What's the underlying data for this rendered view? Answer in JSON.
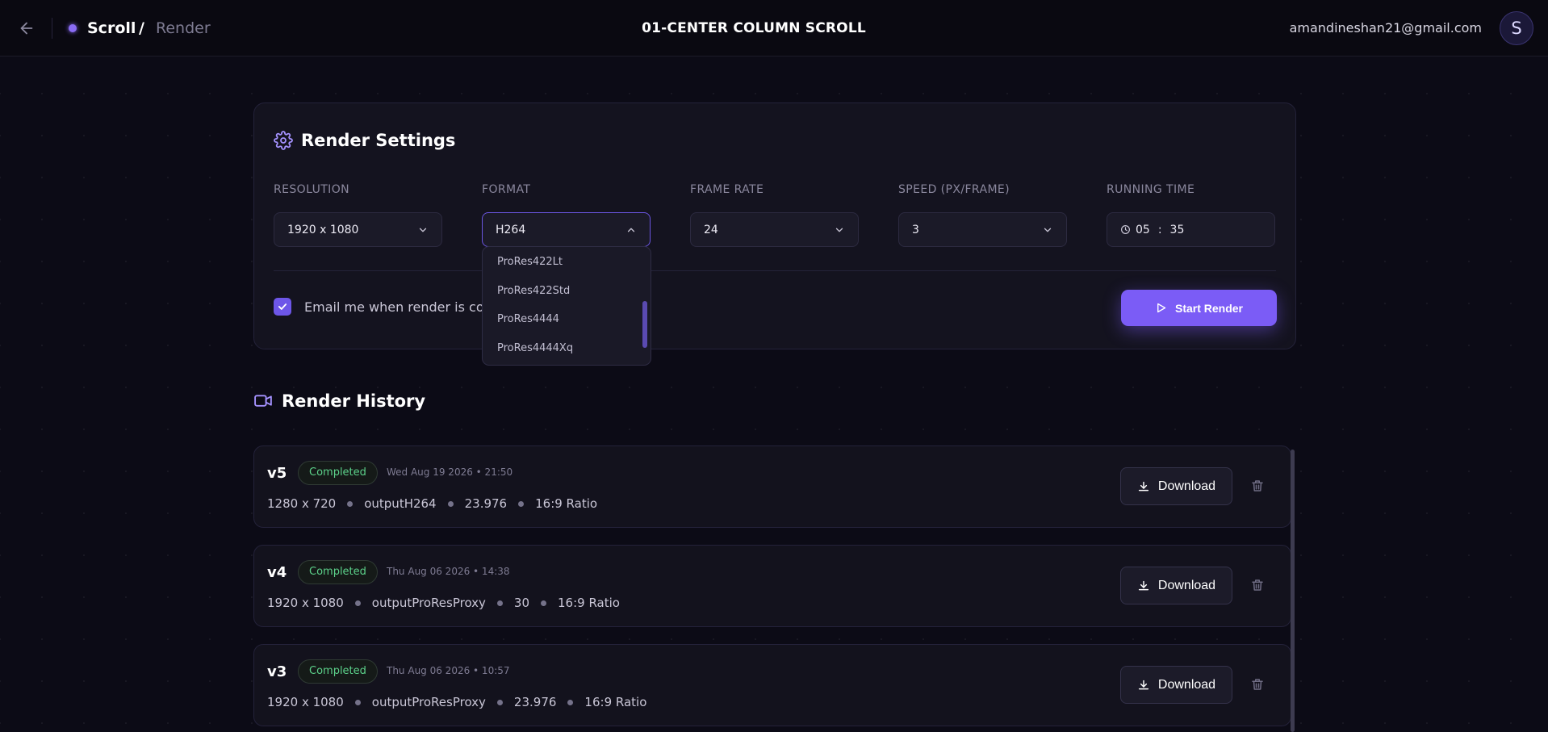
{
  "topbar": {
    "project": "Scroll",
    "separator": "/",
    "page": "Render",
    "title": "01-CENTER COLUMN SCROLL",
    "email": "amandineshan21@gmail.com",
    "avatar_initial": "S"
  },
  "settings": {
    "title": "Render Settings",
    "fields": {
      "resolution": {
        "label": "RESOLUTION",
        "value": "1920 x 1080"
      },
      "format": {
        "label": "FORMAT",
        "value": "H264"
      },
      "frame_rate": {
        "label": "FRAME RATE",
        "value": "24"
      },
      "speed": {
        "label": "SPEED (PX/FRAME)",
        "value": "3"
      },
      "running_time": {
        "label": "RUNNING TIME",
        "minutes": "05",
        "sep": ":",
        "seconds": "35"
      }
    },
    "email_notify_label": "Email me when render is complete",
    "email_notify_checked": true,
    "start_button": "Start Render"
  },
  "format_dropdown": {
    "options": [
      "ProRes422Lt",
      "ProRes422Std",
      "ProRes4444",
      "ProRes4444Xq"
    ]
  },
  "history": {
    "title": "Render History",
    "rows": [
      {
        "version": "v5",
        "status": "Completed",
        "date": "Wed Aug 19 2026 • 21:50",
        "resolution": "1280 x 720",
        "output": "outputH264",
        "fps": "23.976",
        "ratio": "16:9 Ratio",
        "download": "Download"
      },
      {
        "version": "v4",
        "status": "Completed",
        "date": "Thu Aug 06 2026 • 14:38",
        "resolution": "1920 x 1080",
        "output": "outputProResProxy",
        "fps": "30",
        "ratio": "16:9 Ratio",
        "download": "Download"
      },
      {
        "version": "v3",
        "status": "Completed",
        "date": "Thu Aug 06 2026 • 10:57",
        "resolution": "1920 x 1080",
        "output": "outputProResProxy",
        "fps": "23.976",
        "ratio": "16:9 Ratio",
        "download": "Download"
      }
    ]
  },
  "colors": {
    "accent": "#7b5cf6",
    "status_completed": "#5cd18a",
    "background": "#0c0b16"
  },
  "icons": [
    "arrow-left-icon",
    "gear-icon",
    "chevron-down-icon",
    "chevron-up-icon",
    "clock-icon",
    "check-icon",
    "play-icon",
    "video-camera-icon",
    "download-icon",
    "trash-icon"
  ]
}
